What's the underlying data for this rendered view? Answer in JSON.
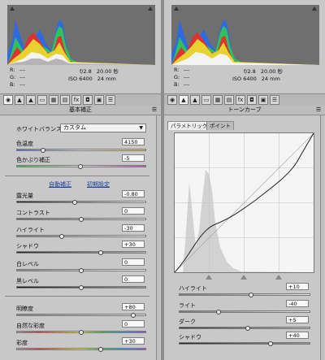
{
  "left": {
    "readout": {
      "r_label": "R:",
      "g_label": "G:",
      "b_label": "B:",
      "r_val": "---",
      "g_val": "---",
      "b_val": "---",
      "aperture": "f/2.8",
      "shutter": "20.00 秒",
      "iso": "ISO 6400",
      "focal": "24 mm"
    },
    "section_title": "基本補正",
    "white_balance": {
      "label": "ホワイトバランス：",
      "value": "カスタム"
    },
    "sliders_wb": [
      {
        "label": "色温度",
        "value": "4150"
      },
      {
        "label": "色かぶり補正",
        "value": "-5"
      }
    ],
    "links": {
      "auto": "自動補正",
      "default": "初期設定"
    },
    "sliders_tone": [
      {
        "label": "露光量",
        "value": "-0.80"
      },
      {
        "label": "コントラスト",
        "value": "0"
      },
      {
        "label": "ハイライト",
        "value": "-30"
      },
      {
        "label": "シャドウ",
        "value": "+30"
      },
      {
        "label": "白レベル",
        "value": "0"
      },
      {
        "label": "黒レベル",
        "value": "0"
      }
    ],
    "sliders_presence": [
      {
        "label": "明瞭度",
        "value": "+80"
      },
      {
        "label": "自然な彩度",
        "value": "0"
      },
      {
        "label": "彩度",
        "value": "+30"
      }
    ]
  },
  "right": {
    "readout": {
      "r_label": "R:",
      "g_label": "G:",
      "b_label": "B:",
      "r_val": "---",
      "g_val": "---",
      "b_val": "---",
      "aperture": "f/2.8",
      "shutter": "20.00 秒",
      "iso": "ISO 6400",
      "focal": "24 mm"
    },
    "section_title": "トーンカーブ",
    "subtabs": {
      "parametric": "パラメトリック",
      "point": "ポイント"
    },
    "sliders": [
      {
        "label": "ハイライト",
        "value": "+10"
      },
      {
        "label": "ライト",
        "value": "-40"
      },
      {
        "label": "ダーク",
        "value": "+5"
      },
      {
        "label": "シャドウ",
        "value": "+40"
      }
    ]
  },
  "tabs": [
    "◉",
    "▲",
    "▲",
    "▭",
    "▦",
    "▤",
    "fx",
    "◘",
    "▣",
    "☰"
  ],
  "icons": {
    "clip_shadow": "shadow-clipping-icon",
    "clip_highlight": "highlight-clipping-icon",
    "menu": "panel-menu-icon"
  }
}
